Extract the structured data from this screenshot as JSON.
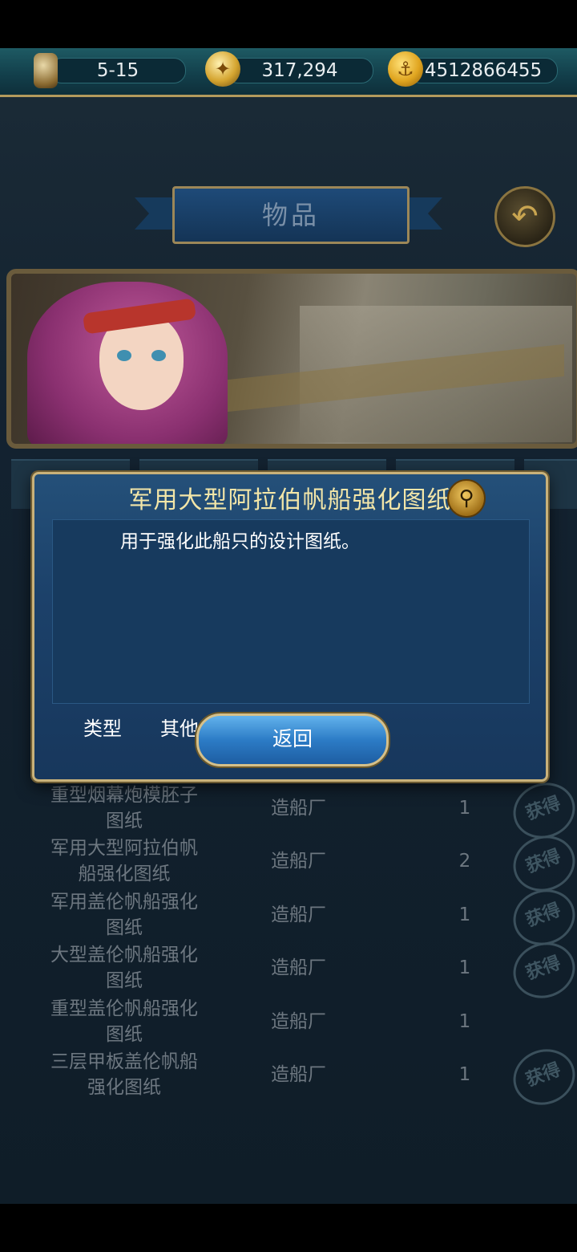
{
  "resources": [
    {
      "icon": "hourglass-icon",
      "value": "5-15"
    },
    {
      "icon": "compass-icon",
      "value": "317,294"
    },
    {
      "icon": "anchor-coin-icon",
      "value": "4512866455"
    }
  ],
  "page": {
    "title": "物品",
    "back_icon": "back-arrow-icon"
  },
  "items": [
    {
      "name": "重型烟幕炮模胚子图纸",
      "source": "造船厂",
      "qty": "1",
      "stamp": "获得"
    },
    {
      "name": "军用大型阿拉伯帆船强化图纸",
      "source": "造船厂",
      "qty": "2",
      "stamp": "获得"
    },
    {
      "name": "军用盖伦帆船强化图纸",
      "source": "造船厂",
      "qty": "1",
      "stamp": "获得"
    },
    {
      "name": "大型盖伦帆船强化图纸",
      "source": "造船厂",
      "qty": "1",
      "stamp": "获得"
    },
    {
      "name": "重型盖伦帆船强化图纸",
      "source": "造船厂",
      "qty": "1",
      "stamp": ""
    },
    {
      "name": "三层甲板盖伦帆船强化图纸",
      "source": "造船厂",
      "qty": "1",
      "stamp": "获得"
    }
  ],
  "dialog": {
    "title": "军用大型阿拉伯帆船强化图纸",
    "description": "用于强化此船只的设计图纸。",
    "type_label": "类型",
    "type_value": "其他",
    "confirm_label": "返回",
    "colors": {
      "title": "#f3e6a8",
      "panel": "#1c416a",
      "border": "#c9b27a"
    }
  }
}
